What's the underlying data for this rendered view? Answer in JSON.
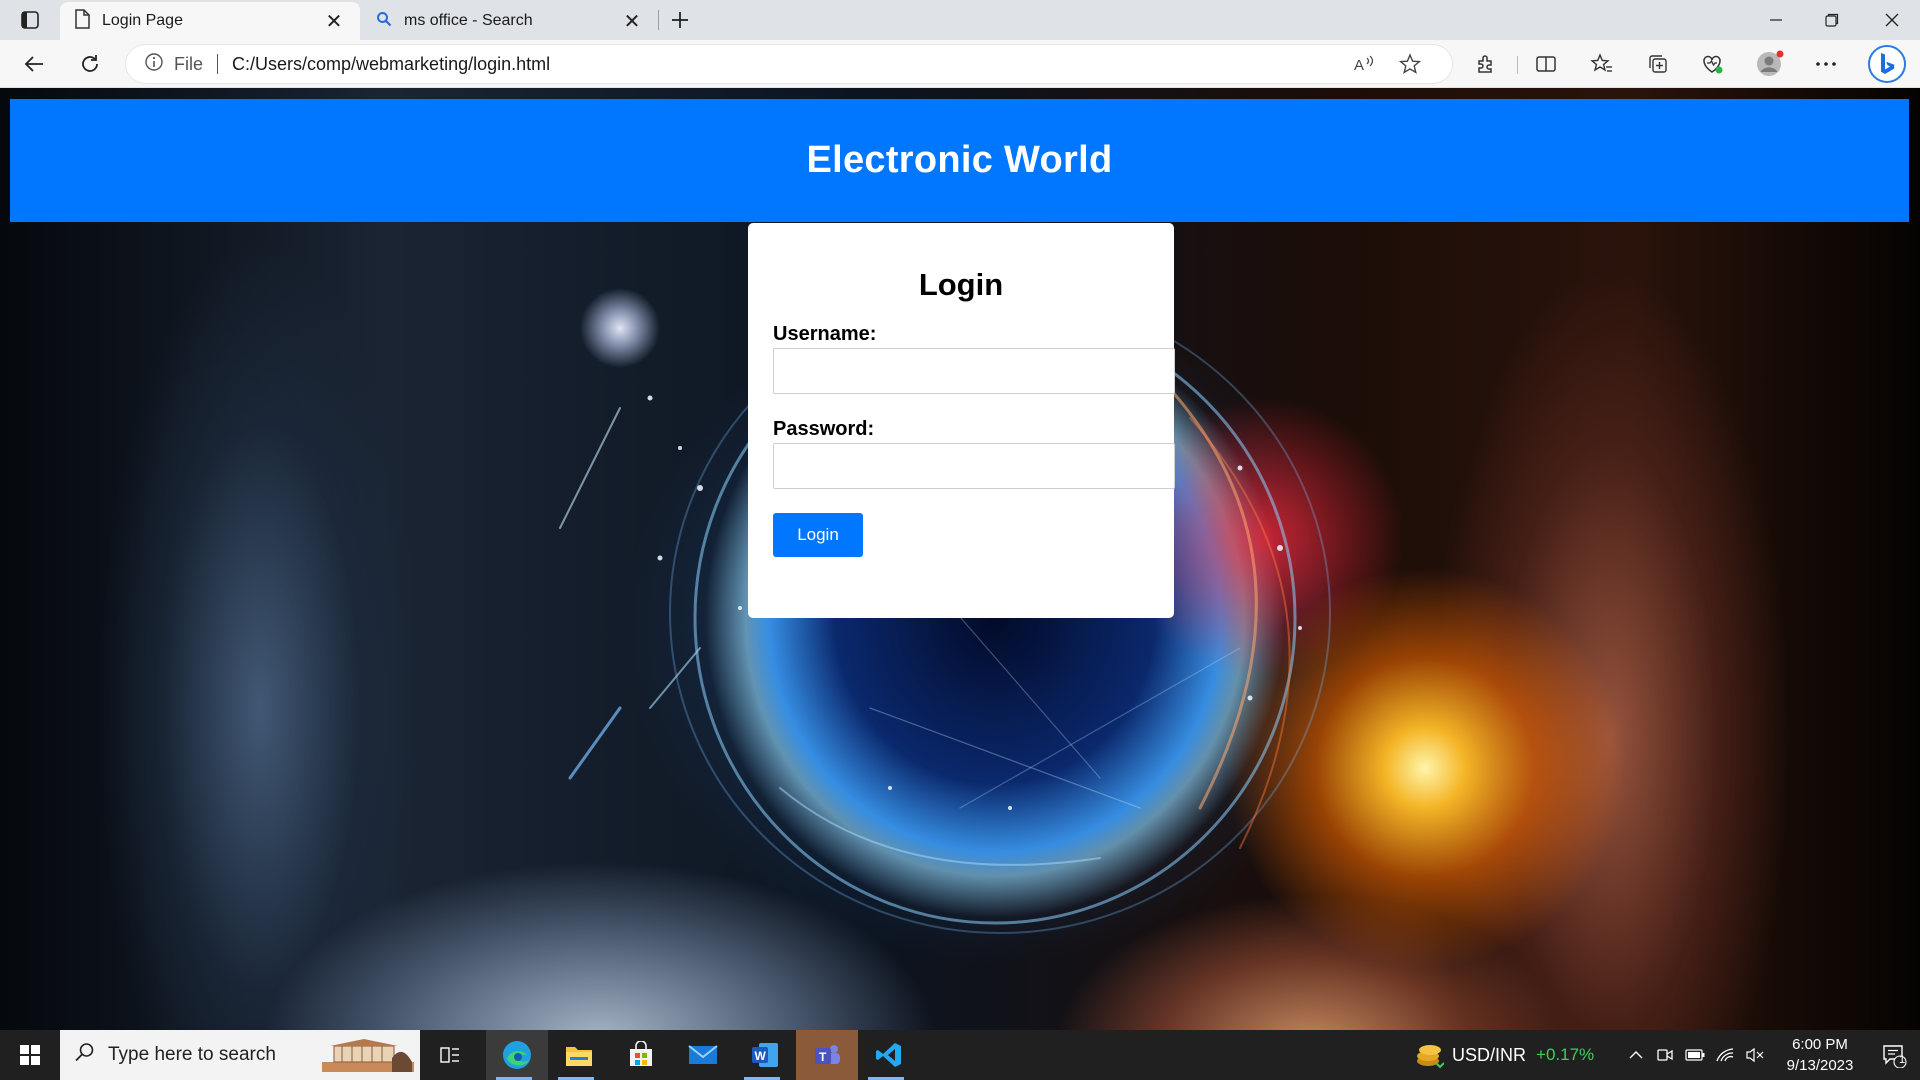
{
  "browser": {
    "tabs": [
      {
        "title": "Login Page",
        "active": true,
        "icon": "page-icon"
      },
      {
        "title": "ms office - Search",
        "active": false,
        "icon": "search-icon"
      }
    ],
    "address": {
      "scheme_label": "File",
      "url": "C:/Users/comp/webmarketing/login.html"
    }
  },
  "page": {
    "site_title": "Electronic World",
    "login": {
      "heading": "Login",
      "username_label": "Username:",
      "username_value": "",
      "password_label": "Password:",
      "password_value": "",
      "button_label": "Login"
    },
    "colors": {
      "header_bg": "#0077fe",
      "button_bg": "#0077fe"
    }
  },
  "taskbar": {
    "search_placeholder": "Type here to search",
    "apps": [
      "task-view",
      "edge",
      "file-explorer",
      "microsoft-store",
      "mail",
      "word",
      "teams",
      "vscode"
    ],
    "ticker": {
      "label": "USD/INR",
      "change": "+0.17%"
    },
    "time": "6:00 PM",
    "date": "9/13/2023",
    "notification_count": "1"
  }
}
